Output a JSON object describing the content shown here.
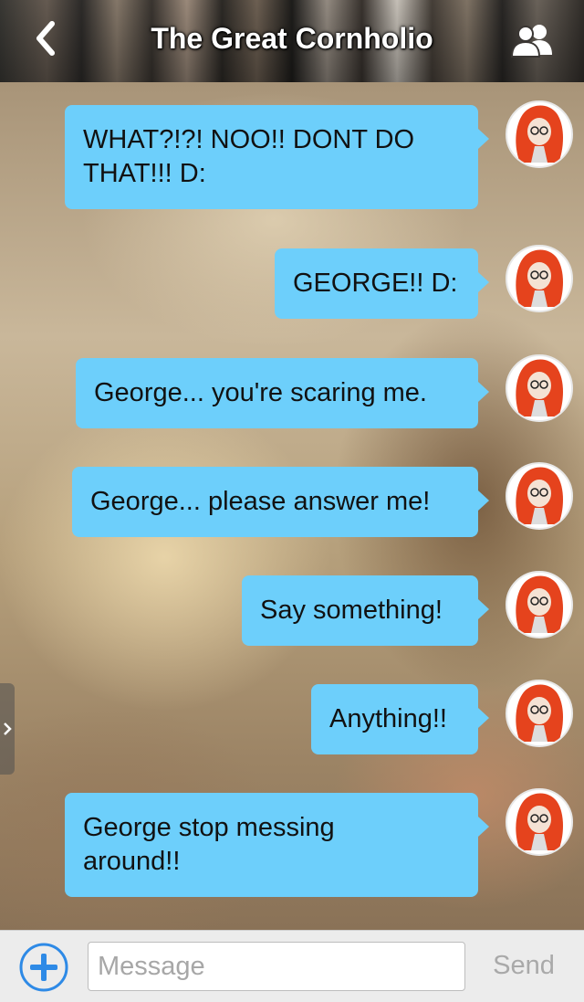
{
  "header": {
    "title": "The Great Cornholio",
    "back_icon": "chevron-left-icon",
    "members_icon": "people-icon"
  },
  "colors": {
    "bubble": "#6dcffb",
    "accent_blue": "#2e8ae6",
    "input_bar": "#ececec"
  },
  "messages": [
    {
      "text": "WHAT?!?! NOO!! DONT DO THAT!!! D:"
    },
    {
      "text": "GEORGE!! D:"
    },
    {
      "text": "George... you're scaring me."
    },
    {
      "text": "George... please answer me!"
    },
    {
      "text": "Say something!"
    },
    {
      "text": "Anything!!"
    },
    {
      "text": "George stop messing around!!"
    }
  ],
  "composer": {
    "placeholder": "Message",
    "value": "",
    "send_label": "Send",
    "add_icon": "plus-circle-icon"
  }
}
